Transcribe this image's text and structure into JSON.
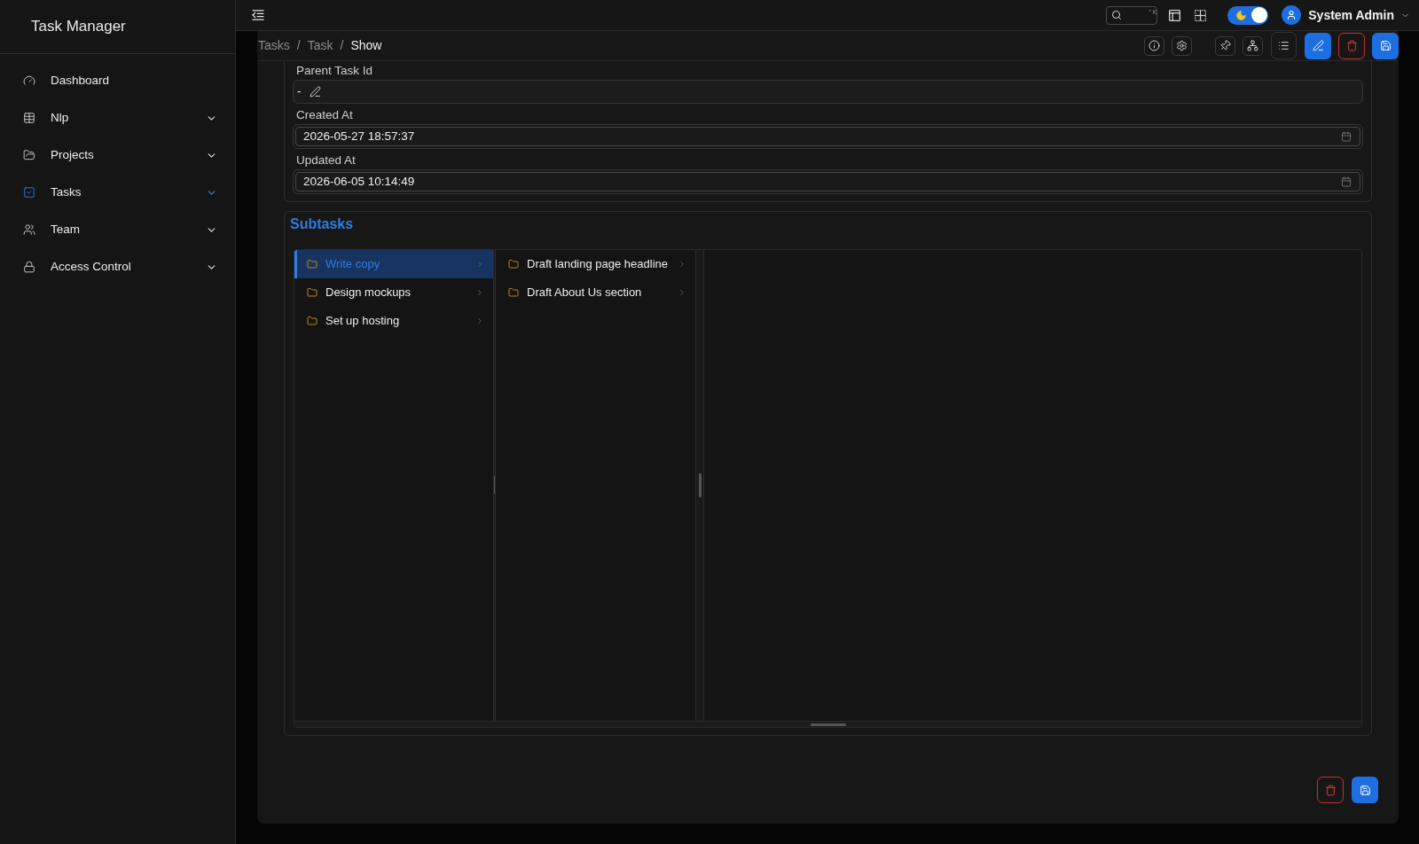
{
  "sidebar": {
    "title": "Task Manager",
    "items": [
      {
        "label": "Dashboard",
        "expandable": false,
        "selected": false
      },
      {
        "label": "Nlp",
        "expandable": true,
        "selected": false
      },
      {
        "label": "Projects",
        "expandable": true,
        "selected": false
      },
      {
        "label": "Tasks",
        "expandable": true,
        "selected": true
      },
      {
        "label": "Team",
        "expandable": true,
        "selected": false
      },
      {
        "label": "Access Control",
        "expandable": true,
        "selected": false
      }
    ]
  },
  "topbar": {
    "search": {
      "shortcut": "⌃K"
    },
    "theme_toggle": {
      "on": true
    },
    "user": {
      "name": "System Admin"
    }
  },
  "breadcrumb": [
    {
      "kind": "link",
      "label": "Tasks"
    },
    {
      "kind": "separator",
      "label": "/"
    },
    {
      "kind": "link",
      "label": "Task"
    },
    {
      "kind": "separator",
      "label": "/"
    },
    {
      "kind": "current",
      "label": "Show"
    }
  ],
  "form": {
    "fields": [
      {
        "label": "Parent Task Id",
        "kind": "text",
        "value": "-"
      },
      {
        "label": "Created At",
        "kind": "datetime",
        "value": "2026-05-27 18:57:37"
      },
      {
        "label": "Updated At",
        "kind": "datetime",
        "value": "2026-06-05 10:14:49"
      }
    ]
  },
  "subtasks": {
    "title": "Subtasks",
    "columns": [
      {
        "items": [
          {
            "label": "Write copy",
            "selected": true
          },
          {
            "label": "Design mockups",
            "selected": false
          },
          {
            "label": "Set up hosting",
            "selected": false
          }
        ]
      },
      {
        "items": [
          {
            "label": "Draft landing page headline",
            "selected": false
          },
          {
            "label": "Draft About Us section",
            "selected": false
          }
        ]
      }
    ]
  }
}
